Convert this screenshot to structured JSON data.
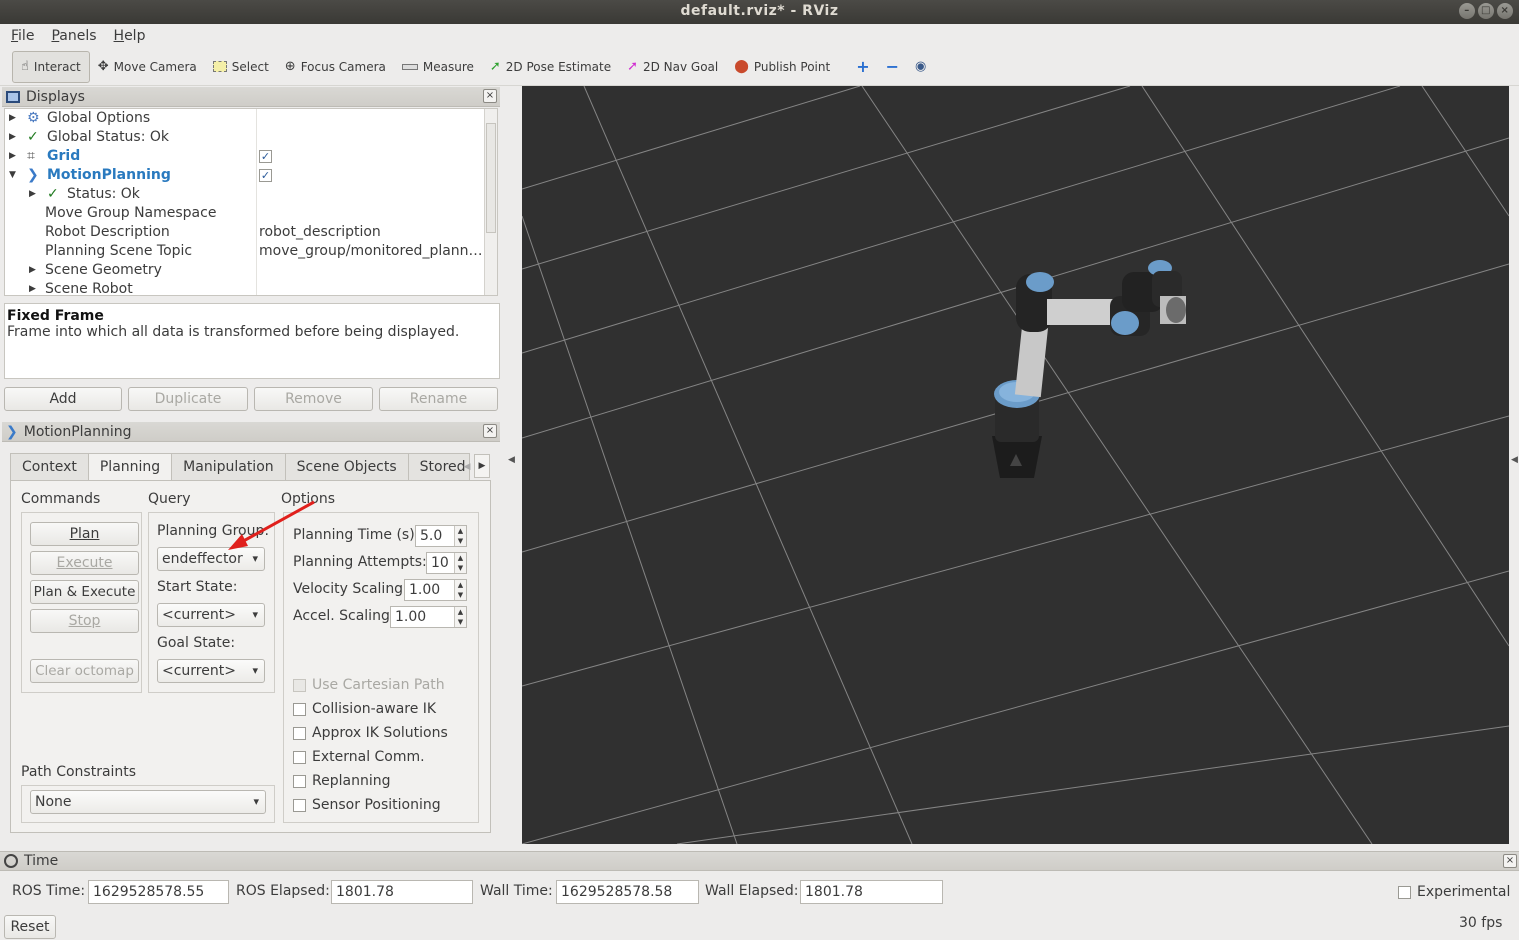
{
  "window": {
    "title": "default.rviz* - RViz"
  },
  "menu": [
    {
      "label": "File",
      "u": "F",
      "rest": "ile"
    },
    {
      "label": "Panels",
      "u": "P",
      "rest": "anels"
    },
    {
      "label": "Help",
      "u": "H",
      "rest": "elp"
    }
  ],
  "toolbar": {
    "interact": "Interact",
    "move_camera": "Move Camera",
    "select": "Select",
    "focus_camera": "Focus Camera",
    "measure": "Measure",
    "pose_estimate": "2D Pose Estimate",
    "nav_goal": "2D Nav Goal",
    "publish_point": "Publish Point"
  },
  "displays": {
    "title": "Displays",
    "rows": [
      {
        "label": "Global Options"
      },
      {
        "label": "Global Status: Ok"
      },
      {
        "label": "Grid"
      },
      {
        "label": "MotionPlanning"
      },
      {
        "label": "Status: Ok"
      },
      {
        "label": "Move Group Namespace",
        "value": ""
      },
      {
        "label": "Robot Description",
        "value": "robot_description"
      },
      {
        "label": "Planning Scene Topic",
        "value": "move_group/monitored_plann…"
      },
      {
        "label": "Scene Geometry"
      },
      {
        "label": "Scene Robot"
      }
    ],
    "desc_title": "Fixed Frame",
    "desc_text": "Frame into which all data is transformed before being displayed.",
    "buttons": {
      "add": "Add",
      "duplicate": "Duplicate",
      "remove": "Remove",
      "rename": "Rename"
    }
  },
  "motion": {
    "title": "MotionPlanning",
    "tabs": [
      "Context",
      "Planning",
      "Manipulation",
      "Scene Objects",
      "Stored"
    ],
    "commands_label": "Commands",
    "query_label": "Query",
    "options_label": "Options",
    "plan": "Plan",
    "execute": "Execute",
    "plan_execute": "Plan & Execute",
    "stop": "Stop",
    "clear_octomap": "Clear octomap",
    "planning_group_label": "Planning Group:",
    "planning_group": "endeffector",
    "start_state_label": "Start State:",
    "start_state": "<current>",
    "goal_state_label": "Goal State:",
    "goal_state": "<current>",
    "planning_time_label": "Planning Time (s):",
    "planning_time": "5.0",
    "planning_attempts_label": "Planning Attempts:",
    "planning_attempts": "10",
    "velocity_label": "Velocity Scaling:",
    "velocity": "1.00",
    "accel_label": "Accel. Scaling:",
    "accel": "1.00",
    "use_cartesian": "Use Cartesian Path",
    "collision_ik": "Collision-aware IK",
    "approx_ik": "Approx IK Solutions",
    "external_comm": "External Comm.",
    "replanning": "Replanning",
    "sensor_pos": "Sensor Positioning",
    "path_constraints_label": "Path Constraints",
    "path_constraints": "None"
  },
  "time": {
    "title": "Time",
    "ros_time_label": "ROS Time:",
    "ros_time": "1629528578.55",
    "ros_elapsed_label": "ROS Elapsed:",
    "ros_elapsed": "1801.78",
    "wall_time_label": "Wall Time:",
    "wall_time": "1629528578.58",
    "wall_elapsed_label": "Wall Elapsed:",
    "wall_elapsed": "1801.78",
    "experimental": "Experimental",
    "reset": "Reset",
    "fps": "30 fps"
  },
  "colors": {
    "accent_blue": "#2a7abf",
    "viewport_bg": "#303030",
    "arrow_red": "#e0201c"
  }
}
